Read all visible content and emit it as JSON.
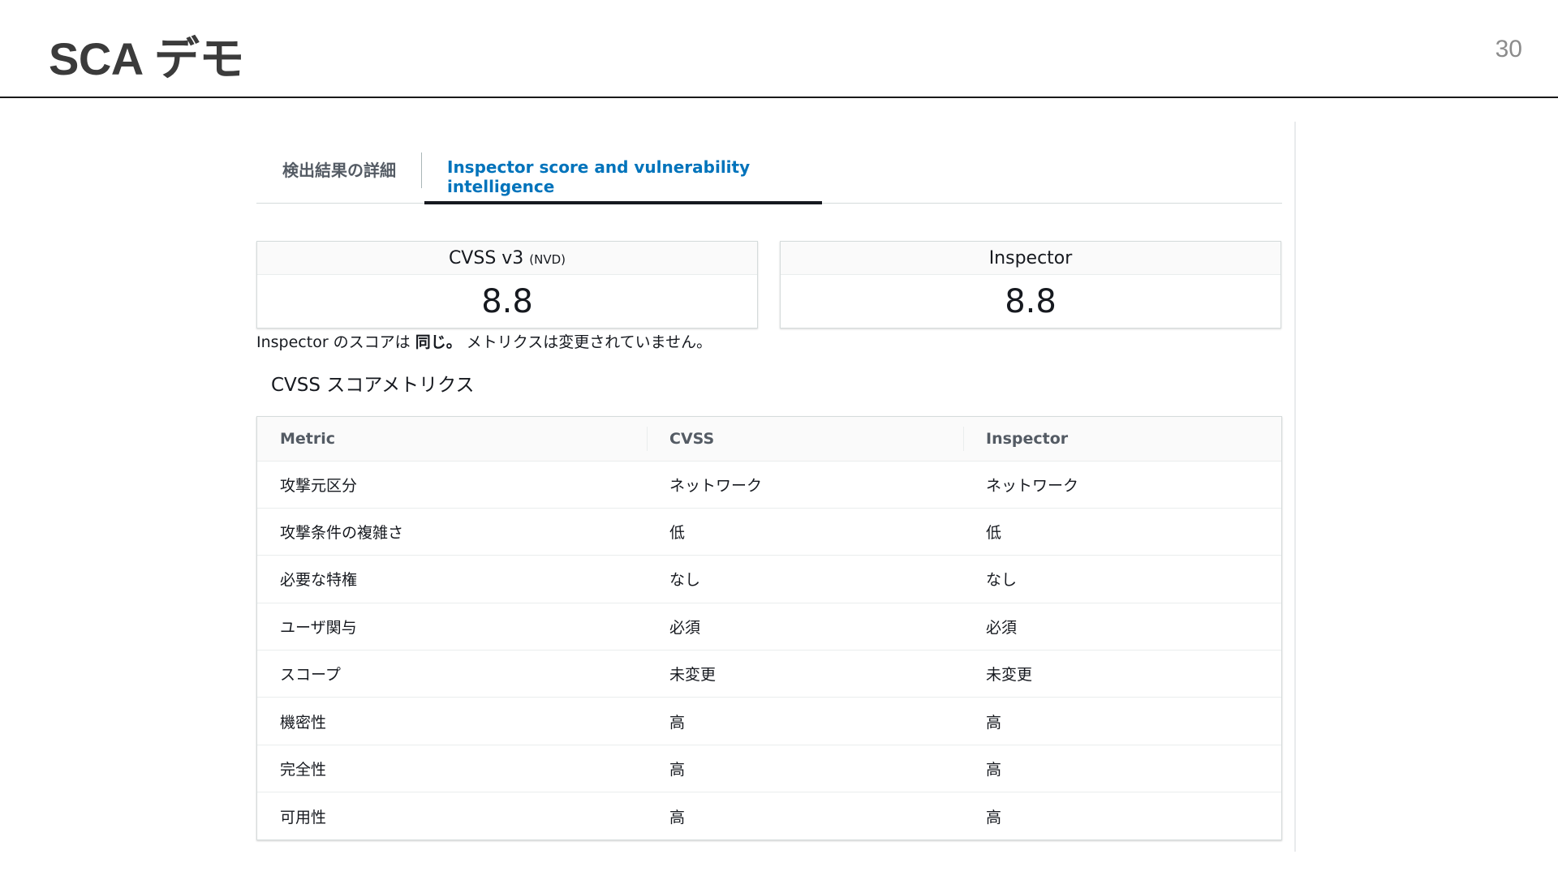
{
  "slide": {
    "title": "SCA デモ",
    "page_number": "30"
  },
  "tabs": [
    {
      "label": "検出結果の詳細",
      "active": false
    },
    {
      "label": "Inspector score and vulnerability intelligence",
      "active": true
    }
  ],
  "scores": {
    "cvss": {
      "label": "CVSS v3",
      "sub": "(NVD)",
      "value": "8.8"
    },
    "inspector": {
      "label": "Inspector",
      "value": "8.8"
    }
  },
  "score_note": {
    "prefix": "Inspector のスコアは ",
    "bold": "同じ。",
    "suffix": " メトリクスは変更されていません。"
  },
  "metrics": {
    "title": "CVSS スコアメトリクス",
    "columns": [
      "Metric",
      "CVSS",
      "Inspector"
    ],
    "rows": [
      [
        "攻撃元区分",
        "ネットワーク",
        "ネットワーク"
      ],
      [
        "攻撃条件の複雑さ",
        "低",
        "低"
      ],
      [
        "必要な特権",
        "なし",
        "なし"
      ],
      [
        "ユーザ関与",
        "必須",
        "必須"
      ],
      [
        "スコープ",
        "未変更",
        "未変更"
      ],
      [
        "機密性",
        "高",
        "高"
      ],
      [
        "完全性",
        "高",
        "高"
      ],
      [
        "可用性",
        "高",
        "高"
      ]
    ]
  },
  "colors": {
    "active_tab": "#0073bb",
    "text": "#16191f",
    "muted": "#545b64",
    "title": "#3b3b3b"
  }
}
